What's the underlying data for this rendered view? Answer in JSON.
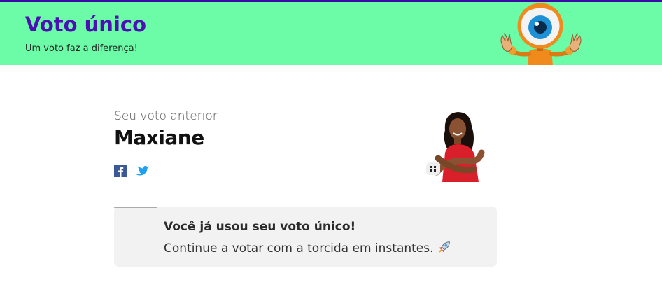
{
  "header": {
    "title": "Voto único",
    "subtitle": "Um voto faz a diferença!",
    "background_color": "#6cfca8",
    "title_color": "#4b0fb3",
    "mascot_icon": "big-brother-eye-mascot"
  },
  "previous_vote": {
    "label": "Seu voto anterior",
    "name": "Maxiane",
    "share": [
      {
        "network": "facebook",
        "icon": "facebook-icon",
        "color": "#3b5998"
      },
      {
        "network": "twitter",
        "icon": "twitter-icon",
        "color": "#1da1f2"
      }
    ],
    "photo_icon": "participant-photo",
    "grid_icon": "grid-icon"
  },
  "notice": {
    "title": "Você já usou seu voto único!",
    "text": "Continue a votar com a torcida em instantes.",
    "icon": "rocket-icon"
  }
}
